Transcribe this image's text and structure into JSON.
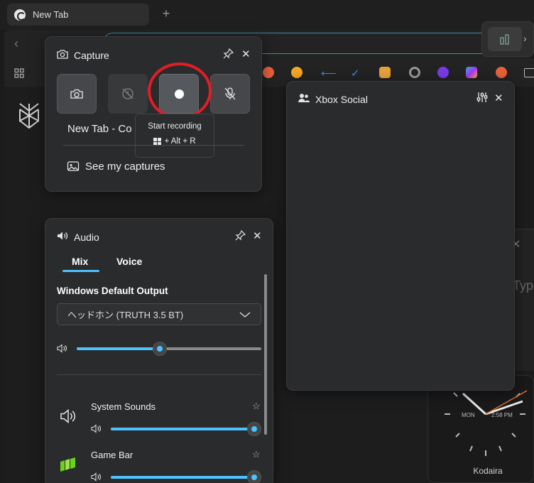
{
  "browser": {
    "tab_title": "New Tab",
    "new_tab_symbol": "+",
    "back_symbol": "‹",
    "extension_chevron": "›",
    "clock_city": "Kodaira",
    "clock_day": "MON",
    "clock_time": "2:58 PM",
    "hidden_text": "Type"
  },
  "capture": {
    "title": "Capture",
    "buttons": [
      {
        "name": "screenshot",
        "state": "enabled"
      },
      {
        "name": "record-last-30-sec",
        "state": "disabled"
      },
      {
        "name": "start-recording",
        "state": "hover"
      },
      {
        "name": "mic-off",
        "state": "enabled"
      }
    ],
    "tooltip_title": "Start recording",
    "tooltip_shortcut": "+ Alt + R",
    "window_title": "New Tab - Co",
    "see_captures": "See my captures"
  },
  "xbox": {
    "title": "Xbox Social"
  },
  "audio": {
    "title": "Audio",
    "tabs": [
      {
        "label": "Mix",
        "active": true
      },
      {
        "label": "Voice",
        "active": false
      }
    ],
    "output_label": "Windows Default Output",
    "device": "ヘッドホン (TRUTH 3.5 BT)",
    "master_volume": 0.45,
    "apps": [
      {
        "label": "System Sounds",
        "volume": 1.0
      },
      {
        "label": "Game Bar",
        "volume": 1.0
      }
    ]
  },
  "colors": {
    "accent": "#4cc2ff",
    "highlight_ring": "#e31d26",
    "panel_bg": "#2a2b2d"
  }
}
